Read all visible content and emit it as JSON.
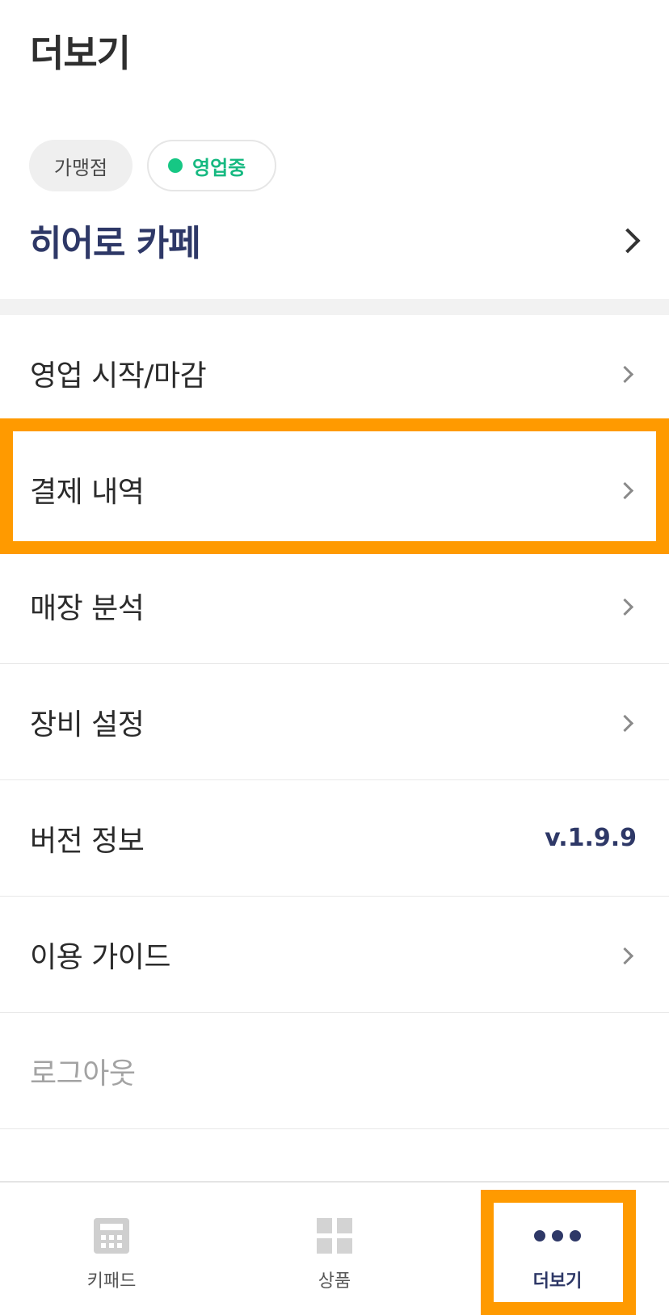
{
  "header": {
    "title": "더보기"
  },
  "store": {
    "type_badge": "가맹점",
    "status_badge": "영업중",
    "name": "히어로 카페",
    "status_color": "#16c784"
  },
  "menu": {
    "items": [
      {
        "label": "영업 시작/마감",
        "icon": "chevron-right-icon"
      },
      {
        "label": "결제 내역",
        "icon": "chevron-right-icon",
        "highlighted": true
      },
      {
        "label": "매장 분석",
        "icon": "chevron-right-icon"
      },
      {
        "label": "장비 설정",
        "icon": "chevron-right-icon"
      },
      {
        "label": "버전 정보",
        "value": "v.1.9.9"
      },
      {
        "label": "이용 가이드",
        "icon": "chevron-right-icon"
      },
      {
        "label": "로그아웃"
      }
    ]
  },
  "tabbar": {
    "tabs": [
      {
        "label": "키패드",
        "icon": "calculator-icon"
      },
      {
        "label": "상품",
        "icon": "grid-icon"
      },
      {
        "label": "더보기",
        "icon": "more-dots-icon",
        "active": true,
        "highlighted": true
      }
    ]
  },
  "colors": {
    "accent": "#2e3867",
    "highlight": "#ff9a00",
    "status_green": "#16c784"
  }
}
